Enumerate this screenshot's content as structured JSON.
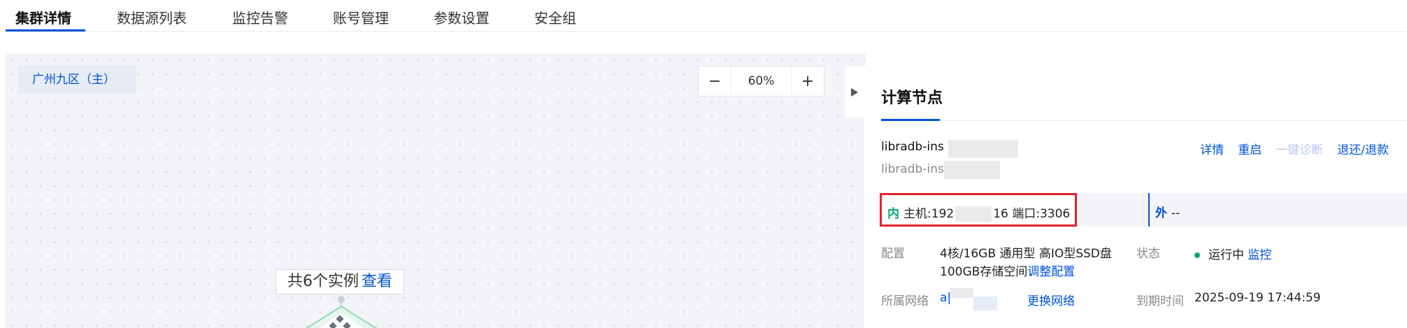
{
  "tabs": [
    "集群详情",
    "数据源列表",
    "监控告警",
    "账号管理",
    "参数设置",
    "安全组"
  ],
  "canvas": {
    "region": "广州九区（主）",
    "zoom": {
      "minus": "−",
      "value": "60%",
      "plus": "+"
    },
    "instances": {
      "text": "共6个实例",
      "view": "查看"
    }
  },
  "panel": {
    "title": "计算节点",
    "node_name": "libradb-ins",
    "node_id": "libradb-ins",
    "actions": {
      "detail": "详情",
      "restart": "重启",
      "diagnose": "一键诊断",
      "refund": "退还/退款"
    },
    "intranet": {
      "tag": "内",
      "host_label": "主机:192",
      "host_tail": "16",
      "port": "端口:3306"
    },
    "extranet": {
      "tag": "外",
      "value": "--"
    },
    "config": {
      "label": "配置",
      "line1": "4核/16GB 通用型 高IO型SSD盘",
      "line2": "100GB存储空间",
      "adjust": "调整配置"
    },
    "status": {
      "label": "状态",
      "value": "运行中",
      "monitor": "监控"
    },
    "network": {
      "label": "所属网络",
      "value": "a|",
      "change": "更换网络"
    },
    "expiry": {
      "label": "到期时间",
      "value": "2025-09-19 17:44:59"
    }
  },
  "colors": {
    "accent": "#0052d9",
    "success": "#00a870",
    "highlight": "#e0252b"
  }
}
